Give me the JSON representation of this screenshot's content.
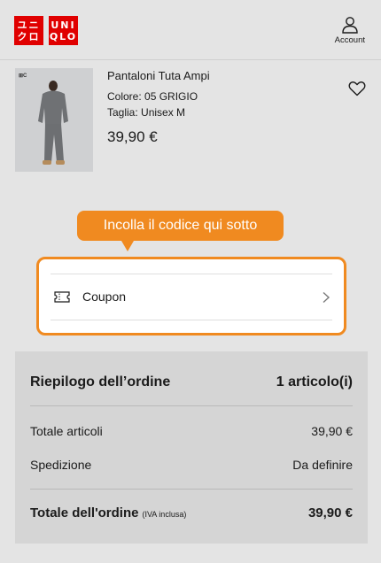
{
  "header": {
    "logo_top": "UNI",
    "logo_bottom": "QLO",
    "logo_jp_top": "ユニ",
    "logo_jp_bottom": "クロ",
    "account_label": "Account"
  },
  "product": {
    "name": "Pantaloni Tuta Ampi",
    "color": "Colore: 05 GRIGIO",
    "size": "Taglia: Unisex M",
    "price": "39,90 €",
    "image_tag": "⊞C"
  },
  "tooltip": {
    "text": "Incolla il codice qui sotto",
    "color": "#f08a20"
  },
  "coupon": {
    "label": "Coupon"
  },
  "summary": {
    "title": "Riepilogo dell’ordine",
    "count": "1 articolo(i)",
    "items_label": "Totale articoli",
    "items_value": "39,90 €",
    "shipping_label": "Spedizione",
    "shipping_value": "Da definire",
    "total_label": "Totale dell'ordine",
    "total_note": "(IVA inclusa)",
    "total_value": "39,90 €"
  },
  "colors": {
    "brand_red": "#e00000",
    "accent_orange": "#f08a20"
  }
}
